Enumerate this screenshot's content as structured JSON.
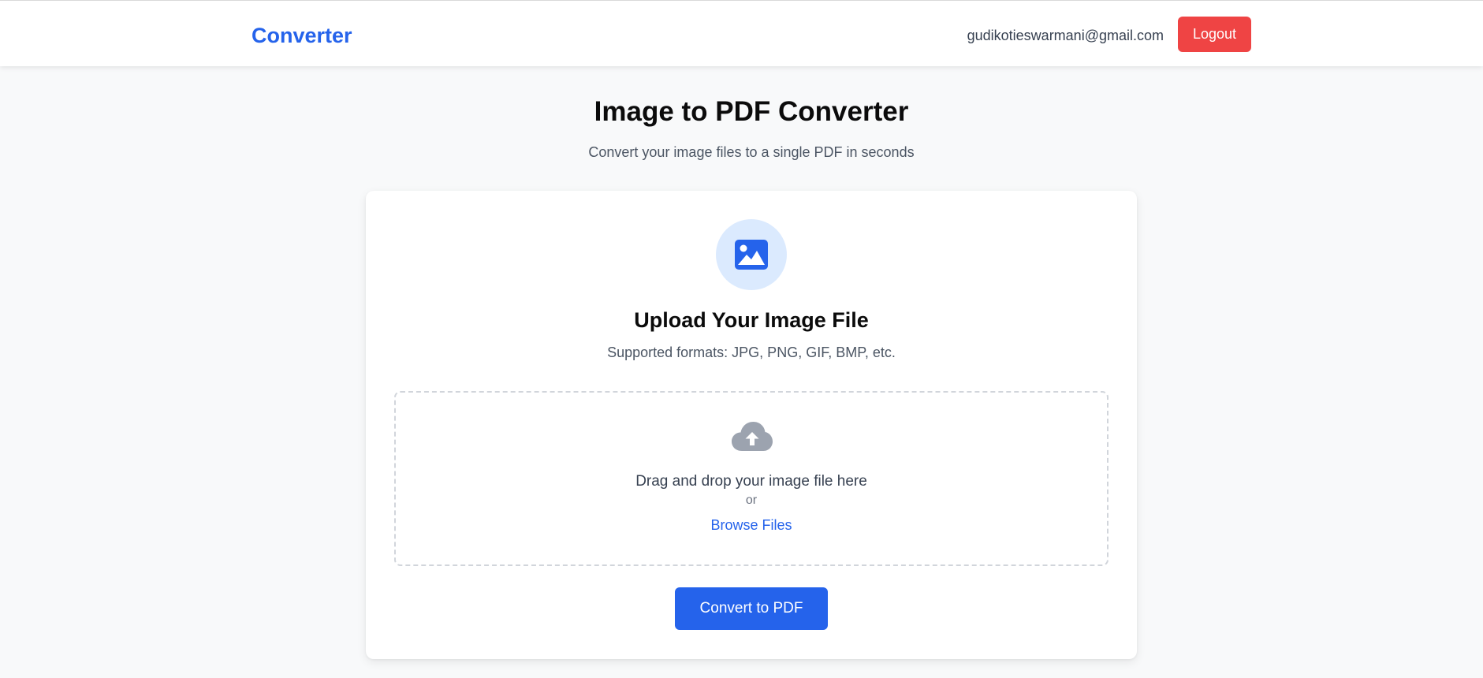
{
  "header": {
    "brand": "Converter",
    "user_email": "gudikotieswarmani@gmail.com",
    "logout_label": "Logout"
  },
  "page": {
    "title": "Image to PDF Converter",
    "subtitle": "Convert your image files to a single PDF in seconds"
  },
  "upload": {
    "icon": "image-icon",
    "title": "Upload Your Image File",
    "formats": "Supported formats: JPG, PNG, GIF, BMP, etc.",
    "dropzone": {
      "icon": "cloud-upload-icon",
      "drag_text": "Drag and drop your image file here",
      "or_text": "or",
      "browse_label": "Browse Files"
    },
    "convert_label": "Convert to PDF"
  },
  "colors": {
    "primary": "#2563eb",
    "danger": "#ef4444",
    "icon_bg": "#dbeafe",
    "page_bg": "#f8f9fa",
    "cloud_icon": "#9ca3af"
  }
}
